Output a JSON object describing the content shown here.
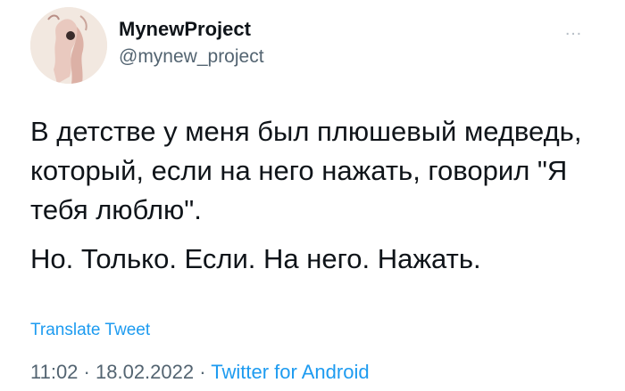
{
  "user": {
    "display_name": "MynewProject",
    "handle": "@mynew_project"
  },
  "more_icon": "…",
  "tweet": {
    "paragraph1": "В детстве у меня был плюшевый медведь, который, если на него нажать, говорил \"Я тебя люблю\".",
    "paragraph2": "Но. Только. Если. На него. Нажать."
  },
  "translate_label": "Translate Tweet",
  "meta": {
    "time": "11:02",
    "separator": "·",
    "date": "18.02.2022",
    "source": "Twitter for Android"
  }
}
